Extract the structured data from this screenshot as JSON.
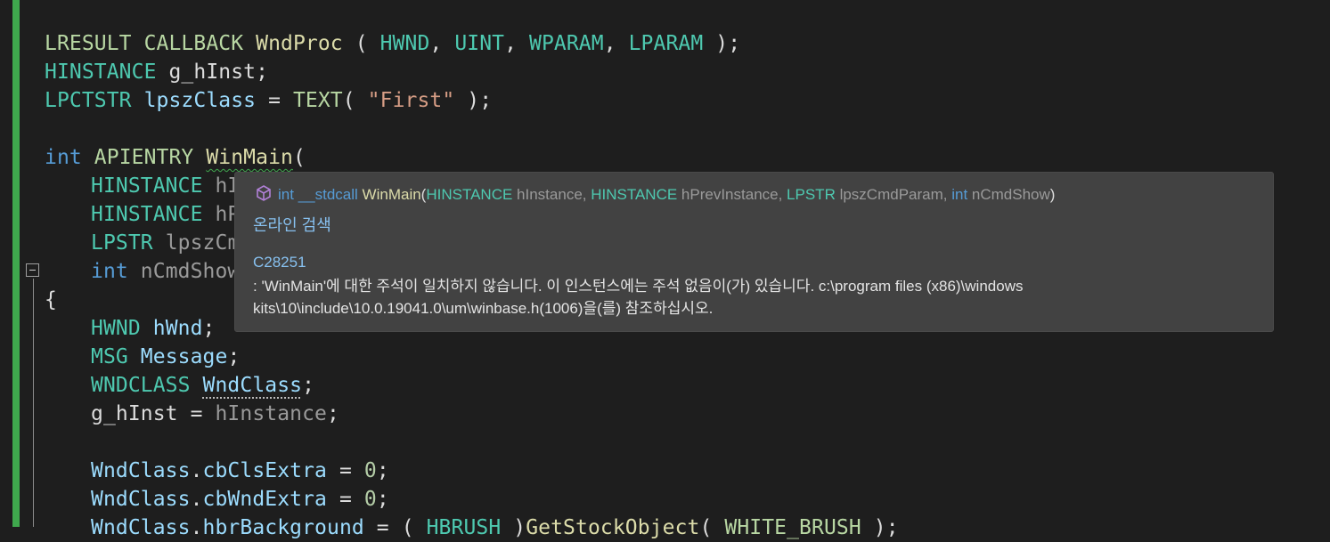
{
  "editor": {
    "lines": [
      {
        "indent": 0,
        "tokens": [
          {
            "t": "LRESULT",
            "c": "m"
          },
          {
            "t": " ",
            "c": "w"
          },
          {
            "t": "CALLBACK",
            "c": "m"
          },
          {
            "t": " ",
            "c": "w"
          },
          {
            "t": "WndProc",
            "c": "f"
          },
          {
            "t": " ( ",
            "c": "w"
          },
          {
            "t": "HWND",
            "c": "t"
          },
          {
            "t": ", ",
            "c": "w"
          },
          {
            "t": "UINT",
            "c": "t"
          },
          {
            "t": ", ",
            "c": "w"
          },
          {
            "t": "WPARAM",
            "c": "t"
          },
          {
            "t": ", ",
            "c": "w"
          },
          {
            "t": "LPARAM",
            "c": "t"
          },
          {
            "t": " );",
            "c": "w"
          }
        ]
      },
      {
        "indent": 0,
        "tokens": [
          {
            "t": "HINSTANCE",
            "c": "t"
          },
          {
            "t": " ",
            "c": "w"
          },
          {
            "t": "g_hInst",
            "c": "w"
          },
          {
            "t": ";",
            "c": "w"
          }
        ]
      },
      {
        "indent": 0,
        "tokens": [
          {
            "t": "LPCTSTR",
            "c": "t"
          },
          {
            "t": " ",
            "c": "w"
          },
          {
            "t": "lpszClass",
            "c": "v"
          },
          {
            "t": " = ",
            "c": "w"
          },
          {
            "t": "TEXT",
            "c": "m"
          },
          {
            "t": "( ",
            "c": "w"
          },
          {
            "t": "\"First\"",
            "c": "s"
          },
          {
            "t": " );",
            "c": "w"
          }
        ]
      },
      {
        "indent": 0,
        "tokens": []
      },
      {
        "indent": 0,
        "tokens": [
          {
            "t": "int",
            "c": "k"
          },
          {
            "t": " ",
            "c": "w"
          },
          {
            "t": "APIENTRY",
            "c": "m"
          },
          {
            "t": " ",
            "c": "w"
          },
          {
            "t": "WinMain",
            "c": "f",
            "deco": "squig"
          },
          {
            "t": "(",
            "c": "w"
          }
        ]
      },
      {
        "indent": 1,
        "tokens": [
          {
            "t": "HINSTANCE",
            "c": "t"
          },
          {
            "t": " ",
            "c": "w"
          },
          {
            "t": "hInstance,",
            "c": "p"
          }
        ]
      },
      {
        "indent": 1,
        "tokens": [
          {
            "t": "HINSTANCE",
            "c": "t"
          },
          {
            "t": " ",
            "c": "w"
          },
          {
            "t": "hPrevInstance,",
            "c": "p"
          }
        ]
      },
      {
        "indent": 1,
        "tokens": [
          {
            "t": "LPSTR",
            "c": "t"
          },
          {
            "t": " ",
            "c": "w"
          },
          {
            "t": "lpszCmdParam,",
            "c": "p"
          }
        ]
      },
      {
        "indent": 1,
        "tokens": [
          {
            "t": "int",
            "c": "k"
          },
          {
            "t": " ",
            "c": "w"
          },
          {
            "t": "nCmdShow",
            "c": "p"
          },
          {
            "t": " )",
            "c": "w"
          }
        ]
      },
      {
        "indent": 0,
        "tokens": [
          {
            "t": "{",
            "c": "w"
          }
        ]
      },
      {
        "indent": 1,
        "tokens": [
          {
            "t": "HWND",
            "c": "t"
          },
          {
            "t": " ",
            "c": "w"
          },
          {
            "t": "hWnd",
            "c": "v"
          },
          {
            "t": ";",
            "c": "w"
          }
        ]
      },
      {
        "indent": 1,
        "tokens": [
          {
            "t": "MSG",
            "c": "t"
          },
          {
            "t": " ",
            "c": "w"
          },
          {
            "t": "Message",
            "c": "v"
          },
          {
            "t": ";",
            "c": "w"
          }
        ]
      },
      {
        "indent": 1,
        "tokens": [
          {
            "t": "WNDCLASS",
            "c": "t"
          },
          {
            "t": " ",
            "c": "w"
          },
          {
            "t": "WndClass",
            "c": "v",
            "deco": "dots"
          },
          {
            "t": ";",
            "c": "w"
          }
        ]
      },
      {
        "indent": 1,
        "tokens": [
          {
            "t": "g_hInst",
            "c": "w"
          },
          {
            "t": " = ",
            "c": "w"
          },
          {
            "t": "hInstance",
            "c": "p"
          },
          {
            "t": ";",
            "c": "w"
          }
        ]
      },
      {
        "indent": 0,
        "tokens": []
      },
      {
        "indent": 1,
        "tokens": [
          {
            "t": "WndClass",
            "c": "v"
          },
          {
            "t": ".",
            "c": "w"
          },
          {
            "t": "cbClsExtra",
            "c": "v"
          },
          {
            "t": " = ",
            "c": "w"
          },
          {
            "t": "0",
            "c": "n"
          },
          {
            "t": ";",
            "c": "w"
          }
        ]
      },
      {
        "indent": 1,
        "tokens": [
          {
            "t": "WndClass",
            "c": "v"
          },
          {
            "t": ".",
            "c": "w"
          },
          {
            "t": "cbWndExtra",
            "c": "v"
          },
          {
            "t": " = ",
            "c": "w"
          },
          {
            "t": "0",
            "c": "n"
          },
          {
            "t": ";",
            "c": "w"
          }
        ]
      },
      {
        "indent": 1,
        "tokens": [
          {
            "t": "WndClass",
            "c": "v"
          },
          {
            "t": ".",
            "c": "w"
          },
          {
            "t": "hbrBackground",
            "c": "v"
          },
          {
            "t": " = ( ",
            "c": "w"
          },
          {
            "t": "HBRUSH",
            "c": "t"
          },
          {
            "t": " )",
            "c": "w"
          },
          {
            "t": "GetStockObject",
            "c": "f"
          },
          {
            "t": "( ",
            "c": "w"
          },
          {
            "t": "WHITE_BRUSH",
            "c": "m"
          },
          {
            "t": " );",
            "c": "w"
          }
        ]
      }
    ]
  },
  "tooltip": {
    "signature": [
      {
        "t": "int",
        "c": "sig-k"
      },
      {
        "t": " ",
        "c": "sig-w"
      },
      {
        "t": "__stdcall",
        "c": "sig-k"
      },
      {
        "t": " ",
        "c": "sig-w"
      },
      {
        "t": "WinMain",
        "c": "sig-f"
      },
      {
        "t": "(",
        "c": "sig-w"
      },
      {
        "t": "HINSTANCE",
        "c": "sig-t"
      },
      {
        "t": " hInstance, ",
        "c": "sig-p"
      },
      {
        "t": "HINSTANCE",
        "c": "sig-t"
      },
      {
        "t": " hPrevInstance, ",
        "c": "sig-p"
      },
      {
        "t": "LPSTR",
        "c": "sig-t"
      },
      {
        "t": " lpszCmdParam, ",
        "c": "sig-p"
      },
      {
        "t": "int",
        "c": "sig-k"
      },
      {
        "t": " nCmdShow",
        "c": "sig-p"
      },
      {
        "t": ")",
        "c": "sig-w"
      }
    ],
    "search_online": "온라인 검색",
    "warning_code": "C28251",
    "message": ": 'WinMain'에 대한 주석이 일치하지 않습니다. 이 인스턴스에는 주석 없음이(가) 있습니다. c:\\program files (x86)\\windows kits\\10\\include\\10.0.19041.0\\um\\winbase.h(1006)을(를) 참조하십시오."
  },
  "icons": {
    "tooltip_symbol": "cube-icon",
    "fold": "collapse-icon"
  },
  "colors": {
    "background": "#1e1e1e",
    "change_bar": "#3fa84d",
    "tooltip_bg": "#424242",
    "link": "#87c0ef"
  }
}
